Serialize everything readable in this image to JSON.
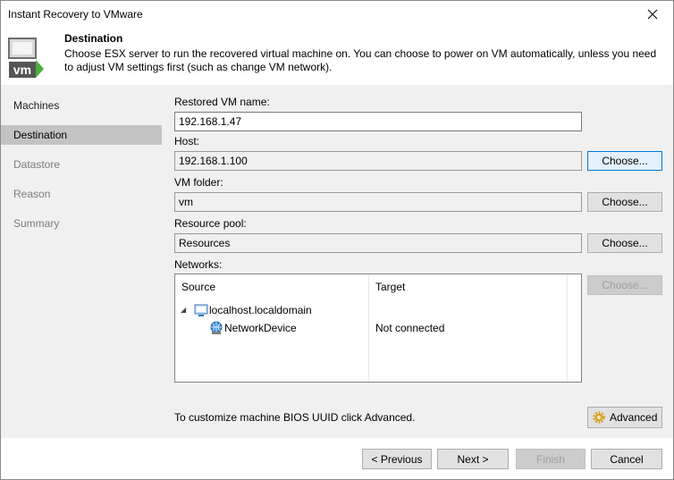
{
  "window": {
    "title": "Instant Recovery to VMware"
  },
  "header": {
    "title": "Destination",
    "description": "Choose ESX server to run the recovered virtual machine on. You can choose to power on VM automatically, unless you need to adjust VM settings first (such as change VM network).",
    "icon_label": "vm"
  },
  "steps": [
    {
      "label": "Machines",
      "state": "done"
    },
    {
      "label": "Destination",
      "state": "active"
    },
    {
      "label": "Datastore",
      "state": "future"
    },
    {
      "label": "Reason",
      "state": "future"
    },
    {
      "label": "Summary",
      "state": "future"
    }
  ],
  "form": {
    "vm_name_label": "Restored VM name:",
    "vm_name_value": "192.168.1.47",
    "host_label": "Host:",
    "host_value": "192.168.1.100",
    "folder_label": "VM folder:",
    "folder_value": "vm",
    "pool_label": "Resource pool:",
    "pool_value": "Resources",
    "networks_label": "Networks:",
    "choose_label": "Choose..."
  },
  "networks": {
    "columns": {
      "source": "Source",
      "target": "Target"
    },
    "host": "localhost.localdomain",
    "device": "NetworkDevice",
    "device_target": "Not connected"
  },
  "uuid_hint": "To customize machine BIOS UUID click Advanced.",
  "advanced_label": "Advanced",
  "footer": {
    "previous": "< Previous",
    "next": "Next >",
    "finish": "Finish",
    "cancel": "Cancel"
  },
  "colors": {
    "vm_icon_green": "#4cad3a",
    "vm_icon_dark": "#555555",
    "active_step": "#c3c3c3",
    "focus_border": "#0078d7"
  }
}
